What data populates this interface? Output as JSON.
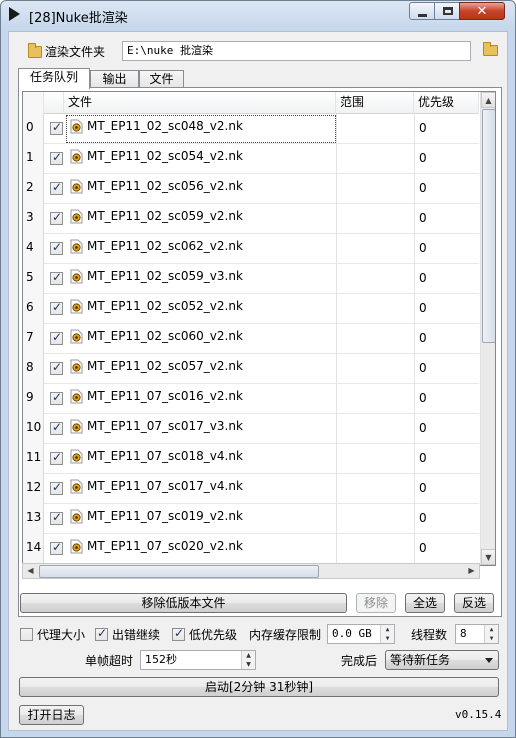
{
  "window": {
    "title": "[28]Nuke批渲染",
    "close_glyph": "✕"
  },
  "folder": {
    "label": "渲染文件夹",
    "path": "E:\\nuke 批渲染"
  },
  "tabs": [
    {
      "label": "任务队列"
    },
    {
      "label": "输出"
    },
    {
      "label": "文件"
    }
  ],
  "table": {
    "headers": {
      "file": "文件",
      "range": "范围",
      "priority": "优先级"
    },
    "rows": [
      {
        "num": "0",
        "file": "MT_EP11_02_sc048_v2.nk",
        "priority": "0"
      },
      {
        "num": "1",
        "file": "MT_EP11_02_sc054_v2.nk",
        "priority": "0"
      },
      {
        "num": "2",
        "file": "MT_EP11_02_sc056_v2.nk",
        "priority": "0"
      },
      {
        "num": "3",
        "file": "MT_EP11_02_sc059_v2.nk",
        "priority": "0"
      },
      {
        "num": "4",
        "file": "MT_EP11_02_sc062_v2.nk",
        "priority": "0"
      },
      {
        "num": "5",
        "file": "MT_EP11_02_sc059_v3.nk",
        "priority": "0"
      },
      {
        "num": "6",
        "file": "MT_EP11_02_sc052_v2.nk",
        "priority": "0"
      },
      {
        "num": "7",
        "file": "MT_EP11_02_sc060_v2.nk",
        "priority": "0"
      },
      {
        "num": "8",
        "file": "MT_EP11_02_sc057_v2.nk",
        "priority": "0"
      },
      {
        "num": "9",
        "file": "MT_EP11_07_sc016_v2.nk",
        "priority": "0"
      },
      {
        "num": "10",
        "file": "MT_EP11_07_sc017_v3.nk",
        "priority": "0"
      },
      {
        "num": "11",
        "file": "MT_EP11_07_sc018_v4.nk",
        "priority": "0"
      },
      {
        "num": "12",
        "file": "MT_EP11_07_sc017_v4.nk",
        "priority": "0"
      },
      {
        "num": "13",
        "file": "MT_EP11_07_sc019_v2.nk",
        "priority": "0"
      },
      {
        "num": "14",
        "file": "MT_EP11_07_sc020_v2.nk",
        "priority": "0"
      }
    ]
  },
  "actions": {
    "remove_old": "移除低版本文件",
    "remove": "移除",
    "select_all": "全选",
    "invert": "反选"
  },
  "options": {
    "proxy": "代理大小",
    "continue_on_error": "出错继续",
    "low_priority": "低优先级",
    "mem_limit_label": "内存缓存限制",
    "mem_limit_value": "0.0 GB",
    "threads_label": "线程数",
    "threads_value": "8",
    "frame_timeout_label": "单帧超时",
    "frame_timeout_value": "152秒",
    "after_label": "完成后",
    "after_value": "等待新任务"
  },
  "start_button": "启动[2分钟 31秒钟]",
  "open_log": "打开日志",
  "version": "v0.15.4"
}
